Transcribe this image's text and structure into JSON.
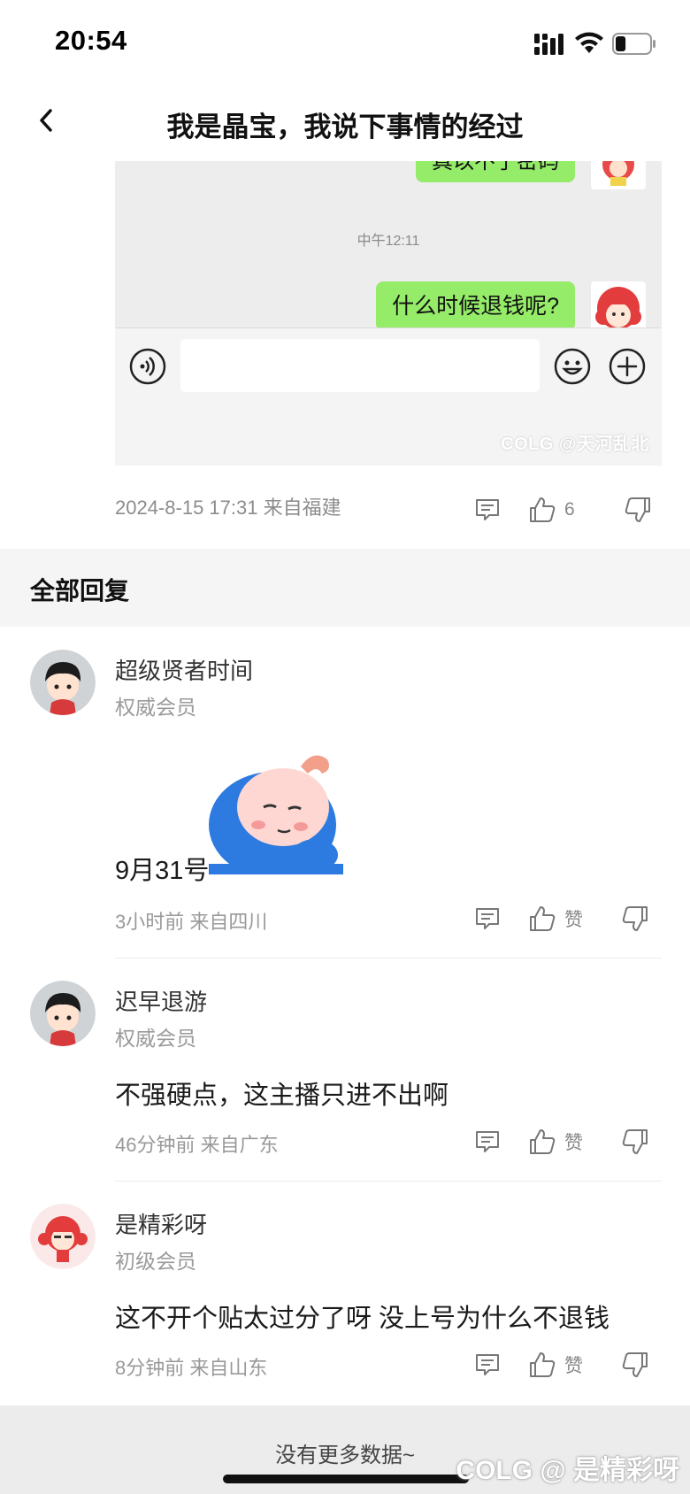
{
  "status_bar": {
    "time": "20:54",
    "signal_icon": "signal-icon",
    "wifi_icon": "wifi-icon",
    "battery_icon": "battery-icon",
    "battery_level": 0.3
  },
  "nav": {
    "back_icon": "chevron-left-icon",
    "title": "我是晶宝，我说下事情的经过"
  },
  "chat_screenshot": {
    "bubble_top_text": "真以不了密码",
    "time_label": "中午12:11",
    "bubble_text": "什么时候退钱呢?",
    "bubble_color": "#95ec69",
    "watermark": "COLG @天河乱北"
  },
  "post": {
    "meta": "2024-8-15 17:31 来自福建",
    "like_count": "6"
  },
  "section": {
    "title": "全部回复"
  },
  "replies": [
    {
      "name": "超级贤者时间",
      "rank": "权威会员",
      "text": "9月31号",
      "meta": "3小时前 来自四川",
      "like_label": "赞",
      "has_sticker": true
    },
    {
      "name": "迟早退游",
      "rank": "权威会员",
      "text": "不强硬点，这主播只进不出啊",
      "meta": "46分钟前 来自广东",
      "like_label": "赞"
    },
    {
      "name": "是精彩呀",
      "rank": "初级会员",
      "text": "这不开个贴太过分了呀 没上号为什么不退钱",
      "meta": "8分钟前 来自山东",
      "like_label": "赞"
    }
  ],
  "footer": {
    "text": "没有更多数据~",
    "watermark": "COLG @ 是精彩呀"
  }
}
